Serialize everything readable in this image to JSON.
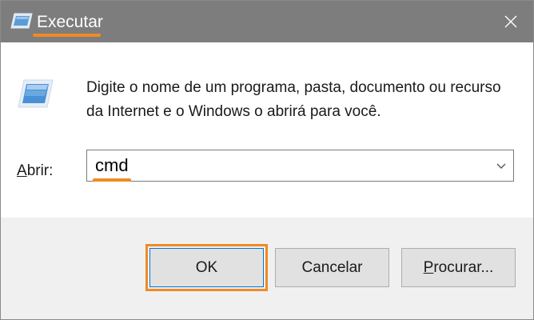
{
  "window": {
    "title": "Executar",
    "icon": "run-icon",
    "close_icon": "close-icon"
  },
  "body": {
    "description": "Digite o nome de um programa, pasta, documento ou recurso da Internet e o Windows o abrirá para você.",
    "open_label_access_key": "A",
    "open_label_rest": "brir:",
    "open_value": "cmd"
  },
  "buttons": {
    "ok": "OK",
    "cancel": "Cancelar",
    "browse_access_key": "P",
    "browse_rest": "rocurar..."
  },
  "colors": {
    "titlebar": "#7d7d7d",
    "highlight": "#f08a24",
    "footer": "#f0f0f0",
    "button": "#e1e1e1"
  }
}
